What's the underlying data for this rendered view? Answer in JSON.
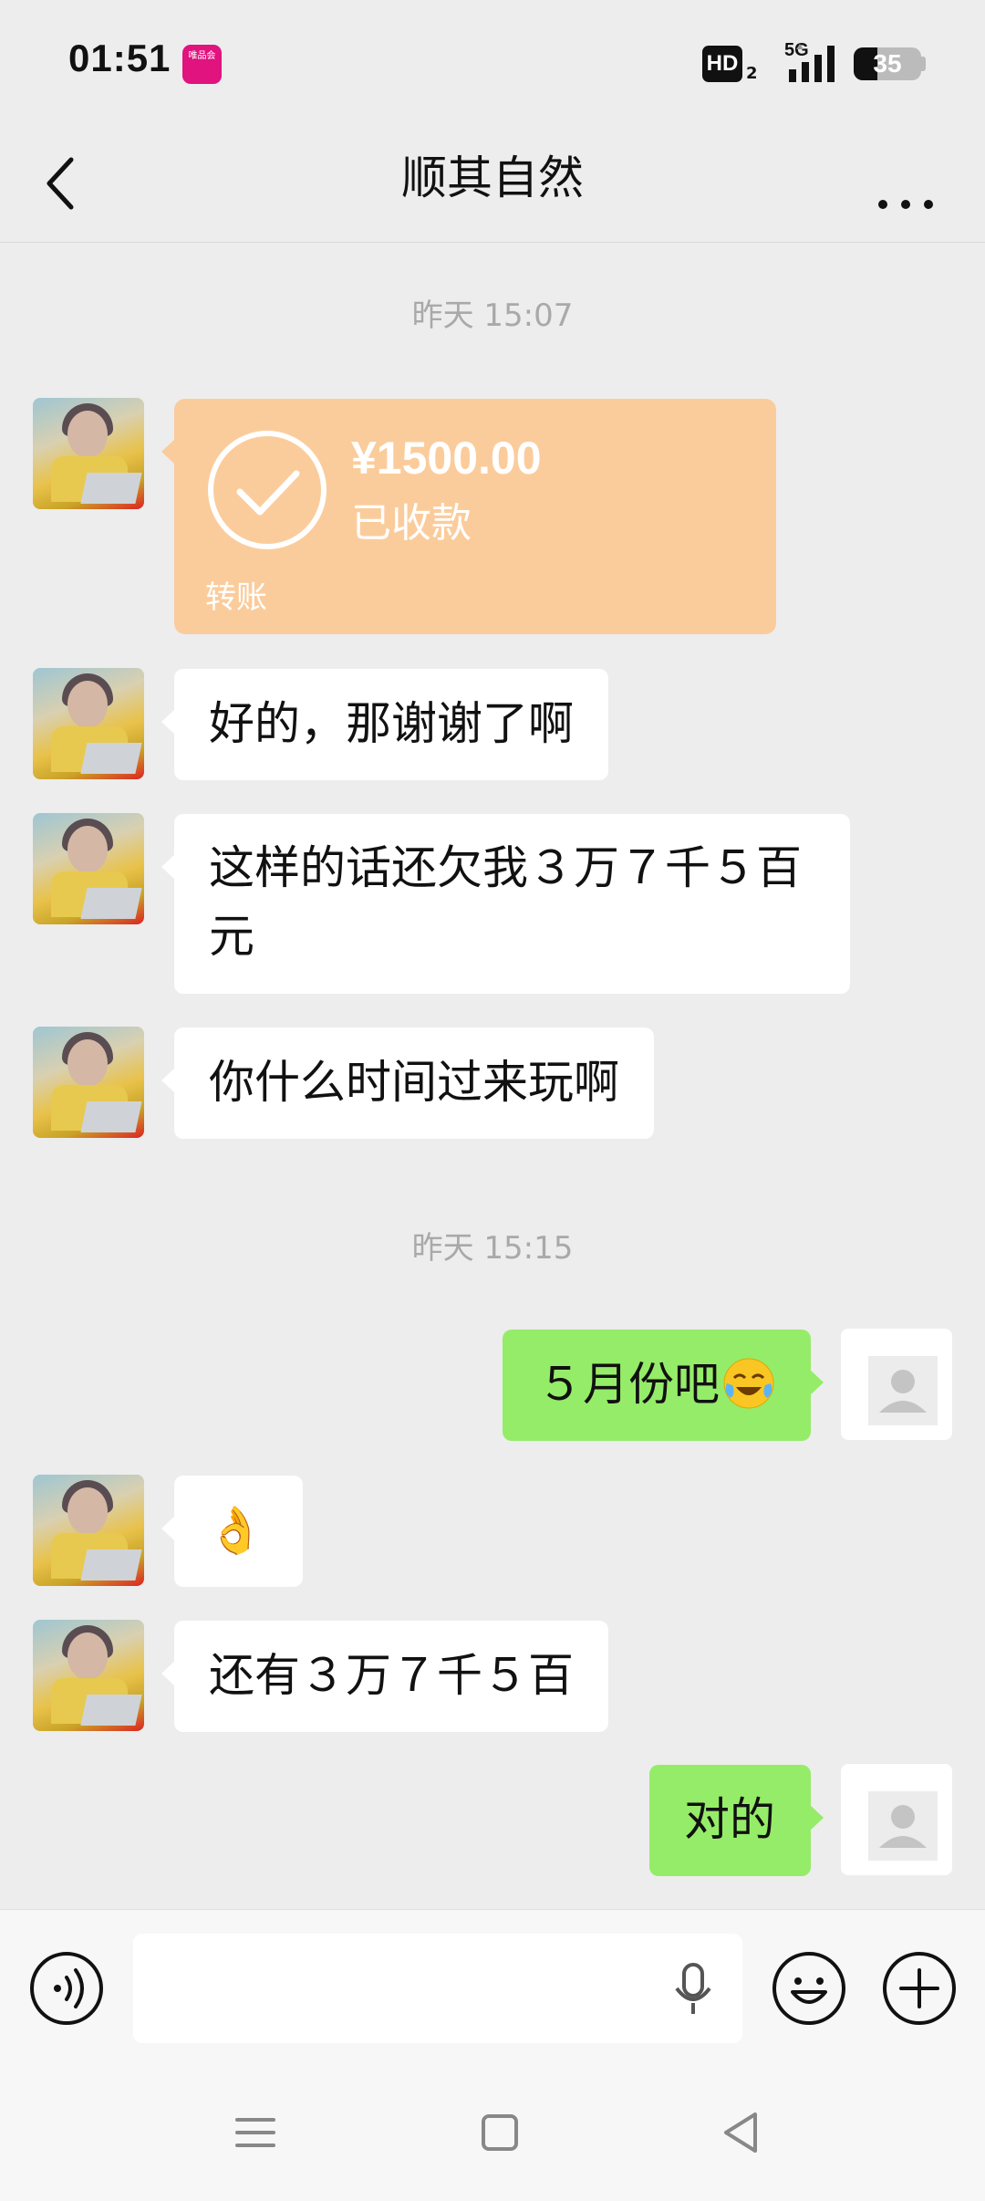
{
  "status_bar": {
    "time": "01:51",
    "app_badge": "唯品会",
    "hd": "HD",
    "hd_sub": "2",
    "network": "5G",
    "battery": "35",
    "battery_level": 0.35
  },
  "header": {
    "title": "顺其自然"
  },
  "messages": {
    "timestamp_1": "昨天 15:07",
    "transfer": {
      "amount": "¥1500.00",
      "status": "已收款",
      "label": "转账"
    },
    "msg_1": "好的，那谢谢了啊",
    "msg_2_line1": "这样的话还欠我３万７千５百",
    "msg_2_line2": "元",
    "msg_3": "你什么时间过来玩啊",
    "timestamp_2": "昨天 15:15",
    "msg_4": "５月份吧",
    "msg_4_emoji": "laughing-crying-emoji",
    "msg_5": "👌",
    "msg_6": "还有３万７千５百",
    "msg_7": "对的"
  },
  "input_bar": {
    "placeholder": ""
  },
  "colors": {
    "background": "#ededed",
    "my_bubble": "#95ec69",
    "friend_bubble": "#ffffff",
    "transfer": "#fbcc9b"
  }
}
